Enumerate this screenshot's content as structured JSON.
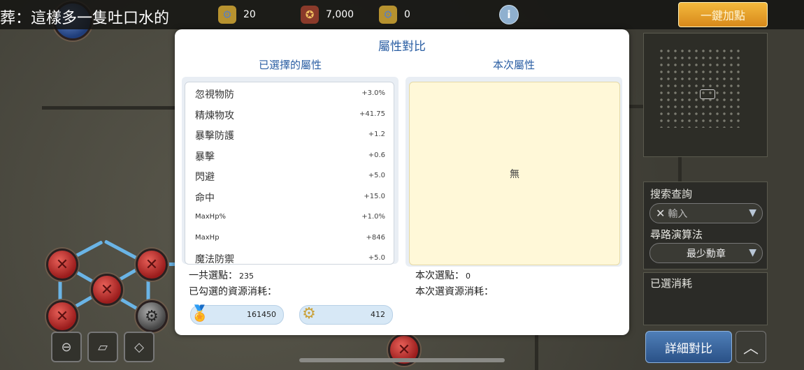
{
  "topbar": {
    "ticker": "葬：這樣多一隻吐口水的",
    "resources": [
      {
        "icon": "gold-gear-icon",
        "value": "20"
      },
      {
        "icon": "medal-lock-icon",
        "value": "7,000"
      },
      {
        "icon": "gear-lock-icon",
        "value": "0"
      }
    ],
    "info_glyph": "i",
    "auto_button": "一鍵加點"
  },
  "dialog": {
    "title": "屬性對比",
    "left_header": "已選擇的屬性",
    "right_header": "本次屬性",
    "attributes": [
      {
        "name": "忽視物防",
        "value": "+3.0%"
      },
      {
        "name": "精煉物攻",
        "value": "+41.75"
      },
      {
        "name": "暴擊防護",
        "value": "+1.2"
      },
      {
        "name": "暴擊",
        "value": "+0.6"
      },
      {
        "name": "閃避",
        "value": "+5.0"
      },
      {
        "name": "命中",
        "value": "+15.0"
      },
      {
        "name": "MaxHp%",
        "value": "+1.0%"
      },
      {
        "name": "MaxHp",
        "value": "+846"
      },
      {
        "name": "魔法防禦",
        "value": "+5.0"
      }
    ],
    "none_text": "無",
    "total_points_label": "一共選點：",
    "total_points_value": "235",
    "checked_cost_label": "已勾選的資源消耗：",
    "current_points_label": "本次選點：",
    "current_points_value": "0",
    "current_cost_label": "本次選資源消耗：",
    "costs": [
      {
        "icon": "medal-icon",
        "value": "161450"
      },
      {
        "icon": "gold-gear-icon",
        "value": "412"
      }
    ]
  },
  "side": {
    "search_label": "搜索查詢",
    "search_placeholder": "輸入",
    "algo_label": "尋路演算法",
    "algo_value": "最少勳章",
    "spent_label": "已選消耗",
    "detail_button": "詳細對比"
  },
  "colors": {
    "accent_blue": "#2a5ea3",
    "gold_button": "#f3b93d",
    "panel_yellow": "#fff8d8"
  }
}
